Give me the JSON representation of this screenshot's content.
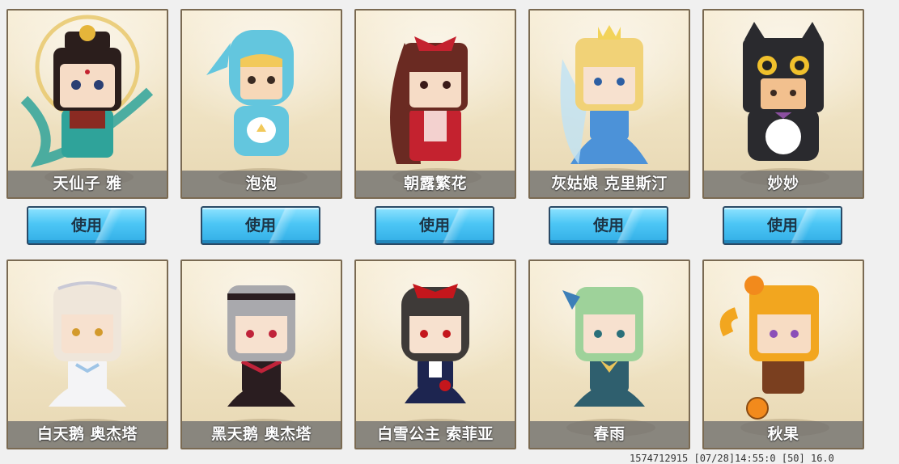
{
  "characters": [
    {
      "name": "天仙子 雅",
      "hair": "#2b1e1c",
      "skin": "#f6dcc6",
      "outfit": "#2fa39a",
      "accent": "#e5b53a"
    },
    {
      "name": "泡泡",
      "hair": "#f2c95a",
      "skin": "#f7d8b8",
      "outfit": "#63c6de",
      "accent": "#ffffff"
    },
    {
      "name": "朝露繁花",
      "hair": "#6a2a22",
      "skin": "#f6dcc6",
      "outfit": "#c4222f",
      "accent": "#f3d1cf"
    },
    {
      "name": "灰姑娘 克里斯汀",
      "hair": "#f1d277",
      "skin": "#f7e1cf",
      "outfit": "#4c92d8",
      "accent": "#bfe2f5"
    },
    {
      "name": "妙妙",
      "hair": "#222222",
      "skin": "#f2c08e",
      "outfit": "#2a2a2e",
      "accent": "#f0c02c"
    },
    {
      "name": "白天鹅 奥杰塔",
      "hair": "#efe6da",
      "skin": "#f7e1cf",
      "outfit": "#f4f4f6",
      "accent": "#c9c9d6"
    },
    {
      "name": "黑天鹅 奥杰塔",
      "hair": "#a9a9ad",
      "skin": "#f7e1cf",
      "outfit": "#2a1d20",
      "accent": "#c0233a"
    },
    {
      "name": "白雪公主 索菲亚",
      "hair": "#3e3a38",
      "skin": "#f7e1cf",
      "outfit": "#1d2550",
      "accent": "#c4161c"
    },
    {
      "name": "春雨",
      "hair": "#9ed29a",
      "skin": "#f7e1cf",
      "outfit": "#2f5f6e",
      "accent": "#e9c45c"
    },
    {
      "name": "秋果",
      "hair": "#f2a61f",
      "skin": "#f7dcc3",
      "outfit": "#7a3f1f",
      "accent": "#f28a1c"
    }
  ],
  "buttons": {
    "use_label": "使用"
  },
  "footer": {
    "text": "1574712915   [07/28]14:55:0  [50]  16.0"
  }
}
